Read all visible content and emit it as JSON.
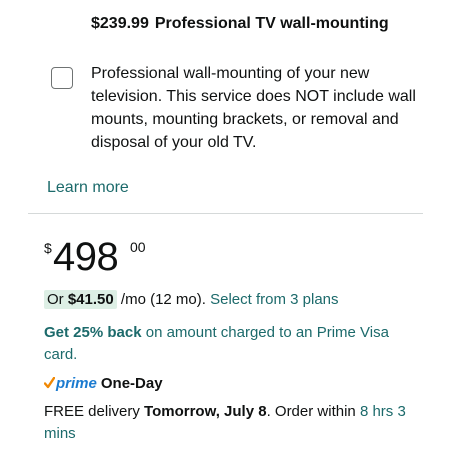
{
  "service": {
    "price": "$239.99",
    "title": "Professional TV wall-mounting",
    "description": "Professional wall-mounting of your new television. This service does NOT include wall mounts, mounting brackets, or removal and disposal of your old TV.",
    "checked": false
  },
  "learn_more": "Learn more",
  "price": {
    "symbol": "$",
    "whole": "498",
    "fraction": "00"
  },
  "monthly": {
    "or_label": "Or",
    "amount": "$41.50",
    "suffix": "/mo (12 mo).",
    "plans_link": "Select from 3 plans"
  },
  "card_offer": {
    "bold": "Get 25% back",
    "rest": "on amount charged to an Prime Visa card."
  },
  "prime": {
    "badge": "prime",
    "label": "One-Day",
    "check_color": "#f08804",
    "brand_color": "#1b7bd0"
  },
  "delivery": {
    "prefix": "FREE delivery",
    "date": "Tomorrow, July 8",
    "order_within": ". Order within",
    "countdown": "8 hrs 3 mins"
  },
  "colors": {
    "link": "#1c6a6b",
    "badge_bg": "#ddefe5",
    "divider": "#d5d9d9"
  }
}
